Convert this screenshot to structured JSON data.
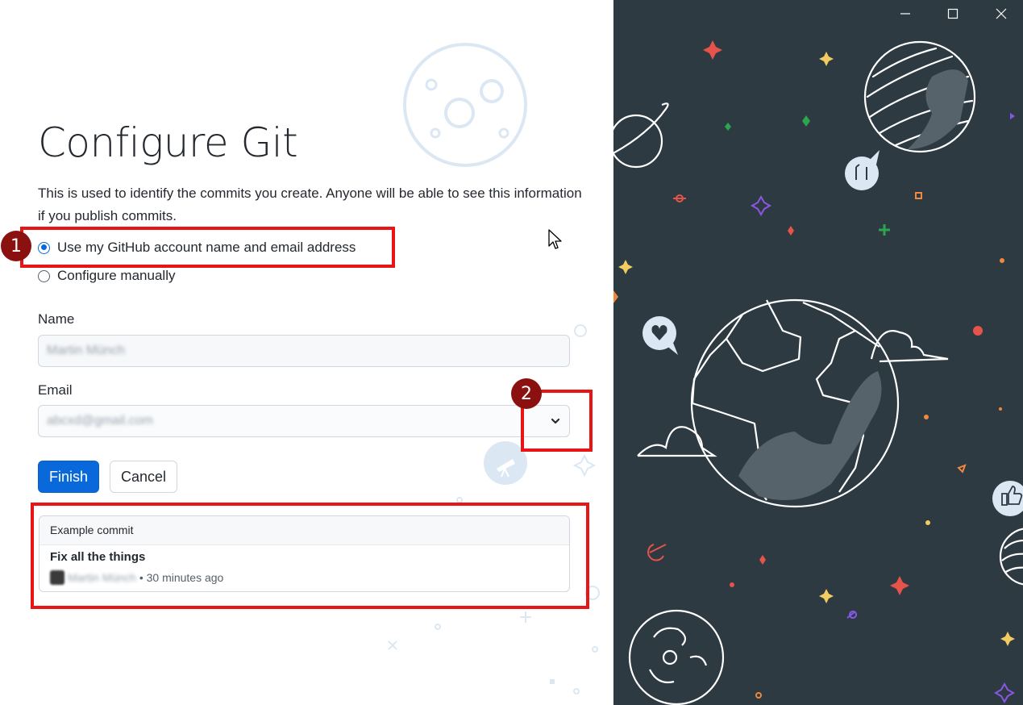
{
  "window": {
    "controls": [
      "minimize-icon",
      "maximize-icon",
      "close-icon"
    ]
  },
  "form": {
    "title": "Configure Git",
    "description": "This is used to identify the commits you create. Anyone will be able to see this information if you publish commits.",
    "options": [
      {
        "label": "Use my GitHub account name and email address",
        "selected": true
      },
      {
        "label": "Configure manually",
        "selected": false
      }
    ],
    "name_label": "Name",
    "name_value": "Martin Münch",
    "email_label": "Email",
    "email_value": "abcxd@gmail.com",
    "finish_label": "Finish",
    "cancel_label": "Cancel"
  },
  "example_commit": {
    "header": "Example commit",
    "title": "Fix all the things",
    "author": "Martin Münch",
    "time": "• 30 minutes ago"
  },
  "annotations": [
    {
      "number": "1",
      "target": "github-account-option"
    },
    {
      "number": "2",
      "target": "email-dropdown"
    },
    {
      "number": "",
      "target": "example-commit"
    }
  ],
  "colors": {
    "accent": "#0969da",
    "annotation": "#e81416",
    "badge": "#8b1010",
    "illustration_bg": "#2d3a42"
  }
}
